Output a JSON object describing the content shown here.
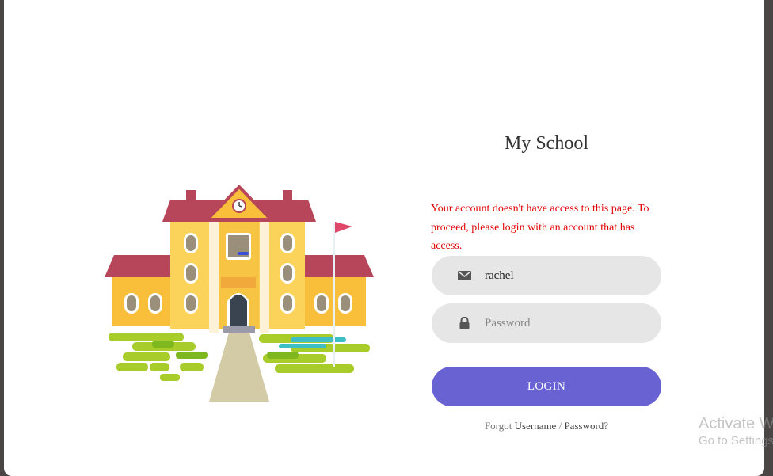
{
  "app": {
    "title": "My School"
  },
  "alert": {
    "message": "Your account doesn't have access to this page. To proceed, please login with an account that has access."
  },
  "login": {
    "username_value": "rachel",
    "password_placeholder": "Password",
    "button_label": "LOGIN",
    "username_icon": "envelope-icon",
    "password_icon": "lock-icon"
  },
  "forgot": {
    "prefix": "Forgot ",
    "username_link": "Username",
    "separator": " / ",
    "password_link": "Password?"
  },
  "watermark": {
    "title": "Activate W",
    "subtitle": "Go to Settings"
  },
  "colors": {
    "accent": "#6962d3",
    "error": "#e00000",
    "field_bg": "#e6e6e6"
  }
}
